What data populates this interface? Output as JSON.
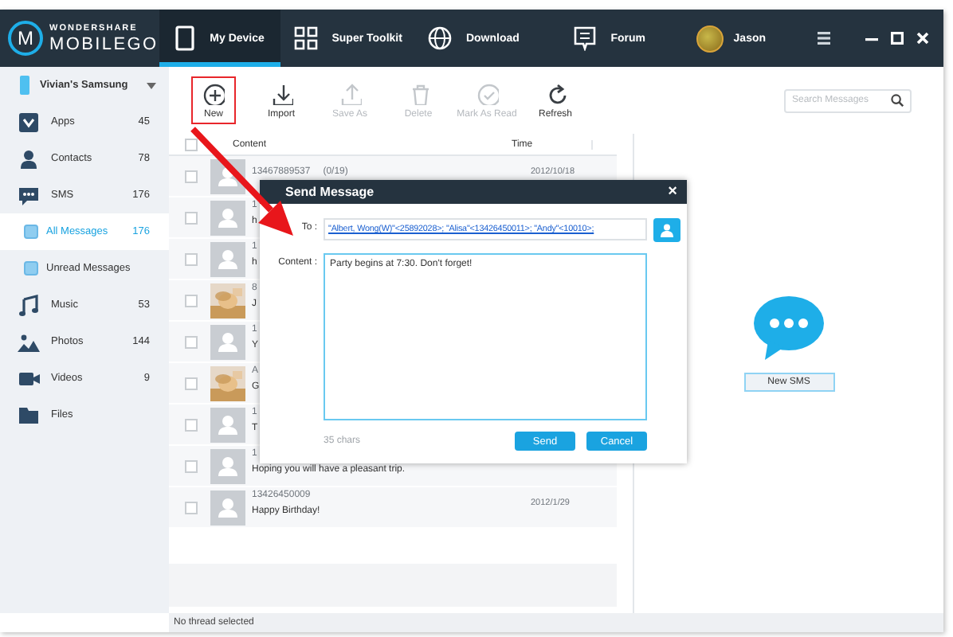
{
  "logo": {
    "top": "WONDERSHARE",
    "bottom": "MOBILEGO",
    "letter": "M"
  },
  "nav_tabs": [
    {
      "label": "My Device",
      "selected": true
    },
    {
      "label": "Super Toolkit",
      "selected": false
    },
    {
      "label": "Download",
      "selected": false
    },
    {
      "label": "Forum",
      "selected": false
    }
  ],
  "user": {
    "name": "Jason"
  },
  "device": {
    "name": "Vivian's Samsung"
  },
  "sidebar": {
    "items": [
      {
        "label": "Apps",
        "count": "45",
        "selected": false
      },
      {
        "label": "Contacts",
        "count": "78",
        "selected": false
      },
      {
        "label": "SMS",
        "count": "176",
        "selected": false,
        "children": [
          {
            "label": "All Messages",
            "count": "176",
            "selected": true
          },
          {
            "label": "Unread Messages",
            "selected": false
          }
        ]
      },
      {
        "label": "Music",
        "count": "53",
        "selected": false
      },
      {
        "label": "Photos",
        "count": "144",
        "selected": false
      },
      {
        "label": "Videos",
        "count": "9",
        "selected": false
      },
      {
        "label": "Files",
        "selected": false
      }
    ]
  },
  "toolbar": [
    {
      "label": "New",
      "disabled": false,
      "highlighted": true
    },
    {
      "label": "Import",
      "disabled": false,
      "highlighted": false
    },
    {
      "label": "Save As",
      "disabled": true,
      "highlighted": false
    },
    {
      "label": "Delete",
      "disabled": true,
      "highlighted": false
    },
    {
      "label": "Mark As Read",
      "disabled": true,
      "highlighted": false
    },
    {
      "label": "Refresh",
      "disabled": false,
      "highlighted": false
    }
  ],
  "search": {
    "placeholder": "Search Messages"
  },
  "list": {
    "columns": [
      "Content",
      "Time"
    ],
    "select_all_checked": false,
    "rows": [
      {
        "kind": "default",
        "checked": false,
        "sender": "13467889537",
        "count": "(0/19)",
        "time": "2012/10/18"
      },
      {
        "kind": "default",
        "checked": false,
        "sender": "1",
        "preview": "h"
      },
      {
        "kind": "default",
        "checked": false,
        "sender": "1",
        "preview": "h"
      },
      {
        "checked": false,
        "sender": "8",
        "preview": "J"
      },
      {
        "kind": "default",
        "checked": false,
        "sender": "1",
        "preview": "Y"
      },
      {
        "checked": false,
        "sender": "A",
        "preview": "G"
      },
      {
        "kind": "default",
        "checked": false,
        "sender": "1",
        "preview": "T"
      },
      {
        "kind": "default",
        "checked": false,
        "sender": "1",
        "preview": "Hoping you will have a pleasant trip."
      },
      {
        "kind": "default",
        "checked": false,
        "sender": "13426450009",
        "time": "2012/1/29",
        "preview": "Happy Birthday!"
      }
    ]
  },
  "dialog": {
    "title": "Send Message",
    "close": "×",
    "to_label": "To :",
    "recipients": "\"Albert, Wong(W)\"<25892028>; \"Alisa\"<13426450011>; \"Andy\"<10010>;",
    "content_label": "Content :",
    "content": "Party begins at 7:30. Don't forget!",
    "char_count": "35 chars",
    "buttons": [
      "Send",
      "Cancel"
    ]
  },
  "pane": {
    "button": "New SMS"
  },
  "status_bar": "No thread selected"
}
